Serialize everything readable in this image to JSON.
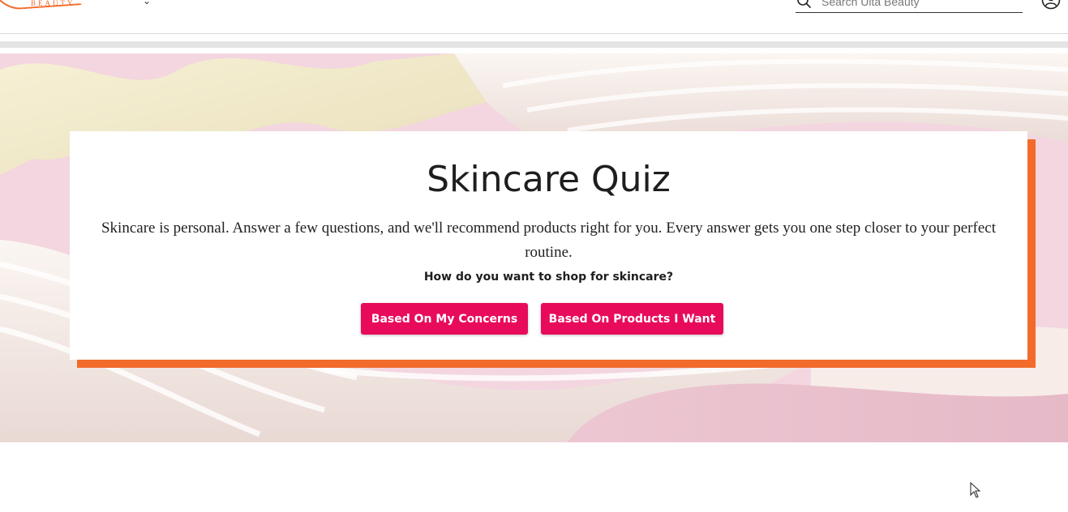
{
  "header": {
    "logo_sub": "BEAUTY",
    "nav_caret": "⌄",
    "search_placeholder": "Search Ulta Beauty",
    "icons": {
      "search": "search-icon",
      "account": "account-icon"
    }
  },
  "quiz": {
    "title": "Skincare Quiz",
    "description": "Skincare is personal. Answer a few questions, and we'll recommend products right for you. Every answer gets you one step closer to your perfect routine.",
    "question": "How do you want to shop for skincare?",
    "buttons": {
      "concerns": "Based On My Concerns",
      "products": "Based On Products I Want"
    }
  },
  "colors": {
    "accent_orange": "#f26b2a",
    "button_pink": "#e80b5c",
    "hero_pink": "#f3d6df"
  }
}
